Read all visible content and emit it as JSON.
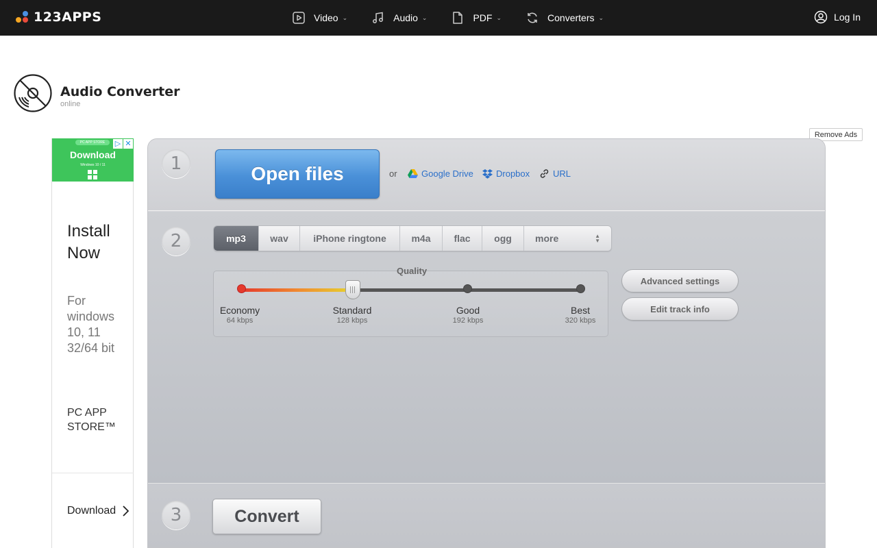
{
  "brand": {
    "name": "123APPS"
  },
  "nav": [
    {
      "label": "Video",
      "icon": "play-icon"
    },
    {
      "label": "Audio",
      "icon": "music-note-icon"
    },
    {
      "label": "PDF",
      "icon": "document-icon"
    },
    {
      "label": "Converters",
      "icon": "convert-icon"
    }
  ],
  "login": {
    "label": "Log In"
  },
  "app": {
    "title": "Audio Converter",
    "subtitle": "online"
  },
  "remove_ads": "Remove Ads",
  "ad": {
    "banner_pill": "PC APP STORE",
    "banner_button": "Download",
    "banner_sub": "Windows 10 / 11",
    "headline": "Install Now",
    "platform": "For windows 10, 11 32/64 bit",
    "store": "PC APP STORE™",
    "cta": "Download"
  },
  "step1": {
    "number": "1",
    "open_files": "Open files",
    "or": "or",
    "sources": [
      "Google Drive",
      "Dropbox",
      "URL"
    ]
  },
  "step2": {
    "number": "2",
    "formats": [
      "mp3",
      "wav",
      "iPhone ringtone",
      "m4a",
      "flac",
      "ogg",
      "more"
    ],
    "selected_format": "mp3",
    "quality_label": "Quality",
    "quality_levels": [
      {
        "name": "Economy",
        "rate": "64 kbps"
      },
      {
        "name": "Standard",
        "rate": "128 kbps"
      },
      {
        "name": "Good",
        "rate": "192 kbps"
      },
      {
        "name": "Best",
        "rate": "320 kbps"
      }
    ],
    "selected_quality": "Standard",
    "advanced_settings": "Advanced settings",
    "edit_track_info": "Edit track info"
  },
  "step3": {
    "number": "3",
    "convert": "Convert"
  },
  "colors": {
    "topbar": "#1a1a1a",
    "accent_blue": "#4a90d8",
    "link": "#2a6fc9",
    "ad_green": "#3ec55b"
  }
}
